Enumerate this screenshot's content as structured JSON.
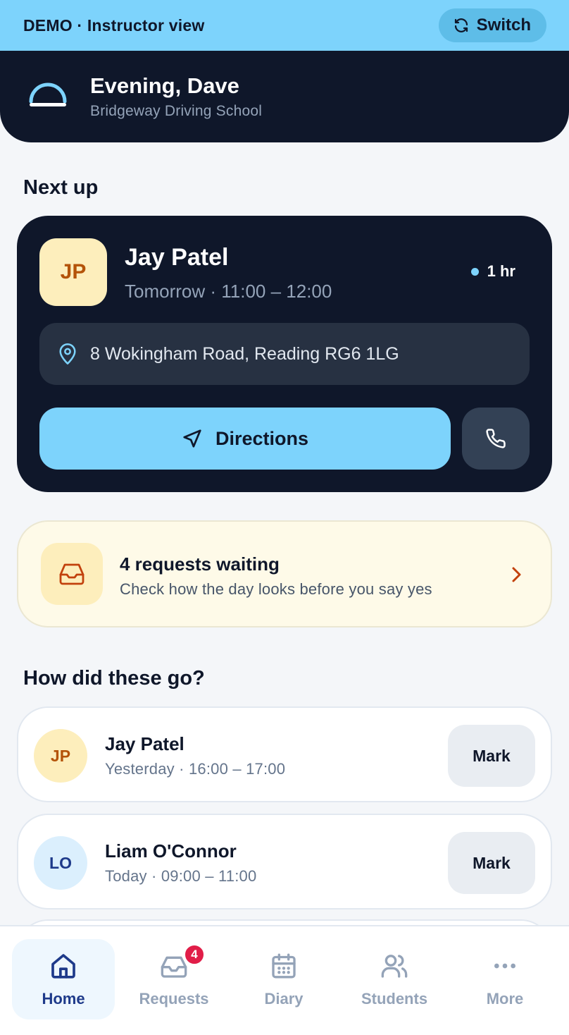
{
  "demo_bar": {
    "label": "DEMO · Instructor view",
    "switch_label": "Switch"
  },
  "header": {
    "greeting": "Evening, Dave",
    "school": "Bridgeway Driving School"
  },
  "next_up": {
    "section_title": "Next up",
    "initials": "JP",
    "student_name": "Jay Patel",
    "time": "Tomorrow · 11:00 – 12:00",
    "duration": "1 hr",
    "address": "8 Wokingham Road, Reading RG6 1LG",
    "directions_label": "Directions"
  },
  "requests": {
    "title": "4 requests waiting",
    "subtitle": "Check how the day looks before you say yes"
  },
  "review": {
    "section_title": "How did these go?",
    "lessons": [
      {
        "initials": "JP",
        "name": "Jay Patel",
        "time": "Yesterday · 16:00 – 17:00",
        "action": "Mark",
        "avatar_bg": "#fdeebc",
        "avatar_fg": "#b45309"
      },
      {
        "initials": "LO",
        "name": "Liam O'Connor",
        "time": "Today · 09:00 – 11:00",
        "action": "Mark",
        "avatar_bg": "#dbeffd",
        "avatar_fg": "#1e3a8a"
      }
    ]
  },
  "nav": {
    "items": [
      {
        "label": "Home",
        "icon": "home-icon",
        "active": true
      },
      {
        "label": "Requests",
        "icon": "inbox-icon",
        "badge": "4"
      },
      {
        "label": "Diary",
        "icon": "calendar-icon"
      },
      {
        "label": "Students",
        "icon": "users-icon"
      },
      {
        "label": "More",
        "icon": "more-icon"
      }
    ]
  },
  "colors": {
    "accent": "#7dd3fc",
    "dark": "#0f172a",
    "badge": "#e11d48"
  }
}
